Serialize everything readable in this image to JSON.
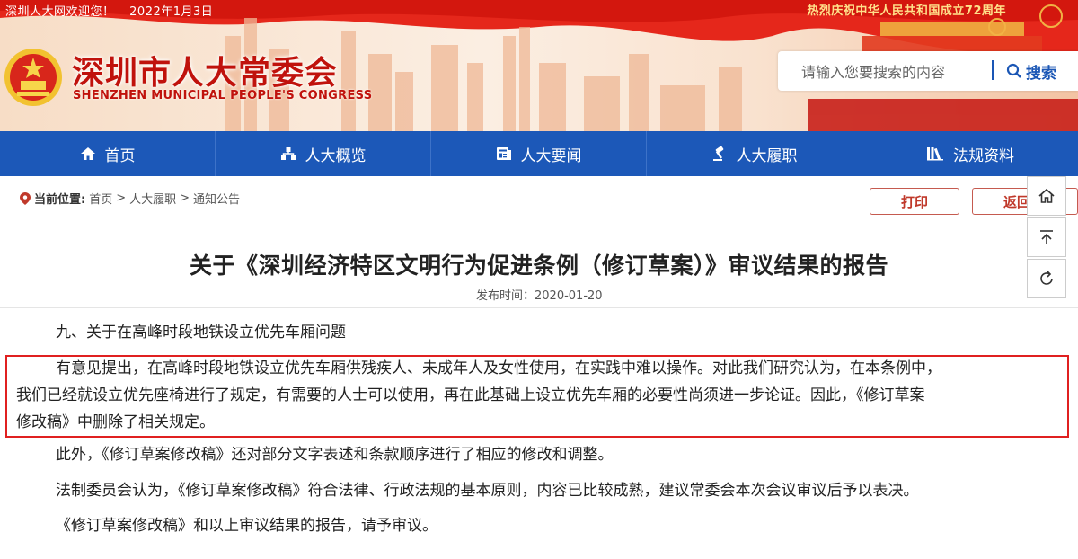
{
  "header": {
    "welcome": "深圳人大网欢迎您！",
    "date": "2022年1月3日",
    "celebration": "热烈庆祝中华人民共和国成立72周年",
    "logo_cn": "深圳市人大常委会",
    "logo_en": "SHENZHEN MUNICIPAL PEOPLE'S CONGRESS",
    "search_placeholder": "请输入您要搜索的内容",
    "search_button": "搜索"
  },
  "nav": {
    "items": [
      {
        "label": "首页",
        "icon": "home-icon"
      },
      {
        "label": "人大概览",
        "icon": "sitemap-icon"
      },
      {
        "label": "人大要闻",
        "icon": "news-icon"
      },
      {
        "label": "人大履职",
        "icon": "hammer-icon"
      },
      {
        "label": "法规资料",
        "icon": "books-icon"
      }
    ]
  },
  "breadcrumb": {
    "label": "当前位置:",
    "items": [
      "首页",
      "人大履职",
      "通知公告"
    ],
    "sep": ">"
  },
  "actions": {
    "print": "打印",
    "back": "返回"
  },
  "sidetools": [
    "home-icon",
    "back-to-top-icon",
    "refresh-icon"
  ],
  "article": {
    "title": "关于《深圳经济特区文明行为促进条例（修订草案）》审议结果的报告",
    "date": "发布时间：2020-01-20",
    "p1": "九、关于在高峰时段地铁设立优先车厢问题",
    "p2_l1": "有意见提出，在高峰时段地铁设立优先车厢供残疾人、未成年人及女性使用，在实践中难以操作。对此我们研究认为，在本条例中，",
    "p2_l2": "我们已经就设立优先座椅进行了规定，有需要的人士可以使用，再在此基础上设立优先车厢的必要性尚须进一步论证。因此，《修订草案",
    "p2_l3": "修改稿》中删除了相关规定。",
    "p3": "此外，《修订草案修改稿》还对部分文字表述和条款顺序进行了相应的修改和调整。",
    "p4": "法制委员会认为，《修订草案修改稿》符合法律、行政法规的基本原则，内容已比较成熟，建议常委会本次会议审议后予以表决。",
    "p5": "《修订草案修改稿》和以上审议结果的报告，请予审议。"
  },
  "colors": {
    "nav": "#1c58b8",
    "brand_red": "#c0120c",
    "highlight": "#e02020"
  }
}
